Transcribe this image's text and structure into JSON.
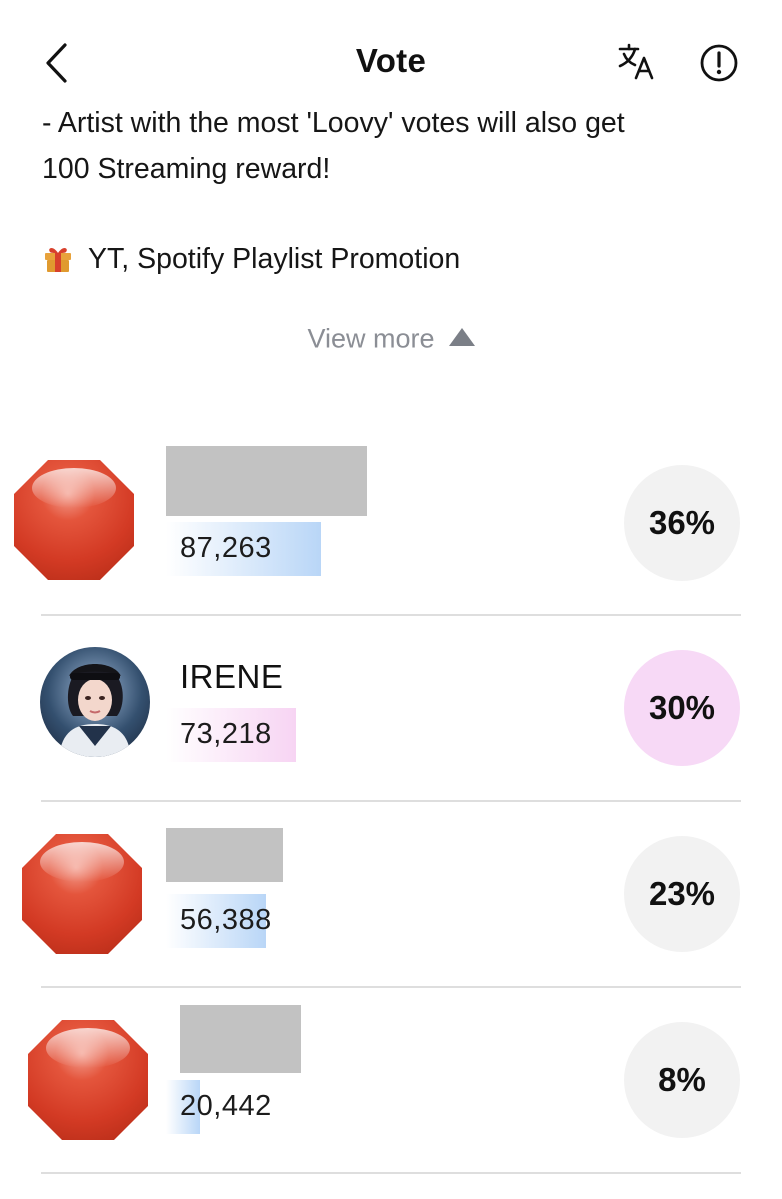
{
  "header": {
    "title": "Vote",
    "back_icon": "chevron-left-icon",
    "translate_icon": "translate-icon",
    "info_icon": "alert-circle-icon"
  },
  "description": {
    "lines": [
      "- Artist with the most 'Loovy' votes will also get",
      "100 Streaming reward!"
    ],
    "promo_icon": "gift-icon",
    "promo": "YT, Spotify Playlist Promotion"
  },
  "view_more": {
    "label": "View more",
    "icon": "triangle-up-icon"
  },
  "colors": {
    "bar_blue": "#b9d6f7",
    "bar_pink": "#f7d4f3",
    "percent_bg": "#f2f2f2",
    "percent_highlight": "#f7d9f6",
    "stop_sign": "#d33a24"
  },
  "candidates": [
    {
      "name": "",
      "name_hidden": true,
      "avatar_icon": "stop-sign-icon",
      "votes": "87,263",
      "percent": "36%",
      "share": 0.36
    },
    {
      "name": "IRENE",
      "name_hidden": false,
      "avatar_icon": "artist-photo",
      "votes": "73,218",
      "percent": "30%",
      "share": 0.3,
      "highlight": true
    },
    {
      "name": "",
      "name_hidden": true,
      "avatar_icon": "stop-sign-icon",
      "votes": "56,388",
      "percent": "23%",
      "share": 0.23
    },
    {
      "name": "",
      "name_hidden": true,
      "avatar_icon": "stop-sign-icon",
      "votes": "20,442",
      "percent": "8%",
      "share": 0.08
    }
  ]
}
